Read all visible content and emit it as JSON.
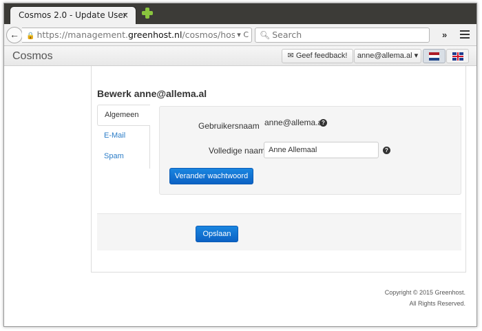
{
  "browser": {
    "tab_title": "Cosmos 2.0 - Update User",
    "tab_close": "×",
    "url_prefix": "https://management.",
    "url_host": "greenhost.nl",
    "url_path": "/cosmos/host",
    "url_tail": "▾ C",
    "search_placeholder": "Search",
    "overflow": "»"
  },
  "app": {
    "brand": "Cosmos",
    "feedback_label": "Geef feedback!",
    "user_label": "anne@allema.al ▾"
  },
  "page": {
    "title": "Bewerk anne@allema.al",
    "tabs": [
      {
        "label": "Algemeen"
      },
      {
        "label": "E-Mail"
      },
      {
        "label": "Spam"
      }
    ],
    "form": {
      "username_label": "Gebruikersnaam",
      "username_value": "anne@allema.al",
      "fullname_label": "Volledige naam",
      "fullname_value": "Anne Allemaal",
      "change_password_label": "Verander wachtwoord"
    },
    "save_label": "Opslaan"
  },
  "footer": {
    "copyright": "Copyright © 2015 Greenhost.",
    "rights": "All Rights Reserved."
  },
  "colors": {
    "primary": "#0c62c4",
    "link": "#2a7cc7",
    "tabstrip": "#3c3b37",
    "newtab_plus": "#8ac53e"
  }
}
